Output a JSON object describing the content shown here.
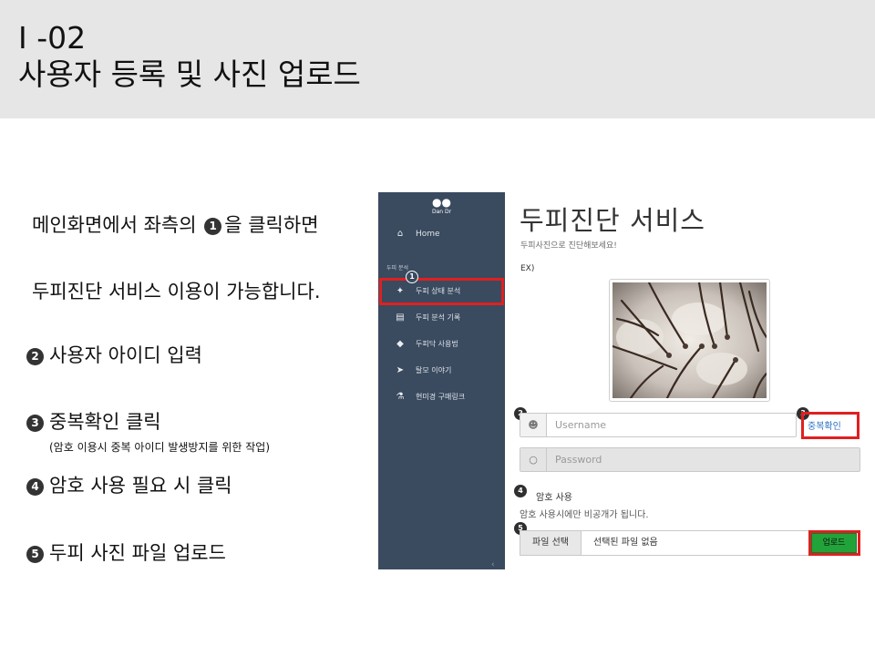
{
  "header": {
    "code": "I -02",
    "title": "사용자 등록 및 사진 업로드"
  },
  "instructions": {
    "line1_pre": "메인화면에서 좌측의 ",
    "line1_num": "1",
    "line1_post": "을 클릭하면",
    "line2": "두피진단 서비스 이용이 가능합니다.",
    "step2_num": "2",
    "step2": "사용자 아이디 입력",
    "step3_num": "3",
    "step3": "중복확인 클릭",
    "step3_note": "(암호 이용시 중복 아이디 발생방지를 위한 작업)",
    "step4_num": "4",
    "step4": "암호 사용 필요 시 클릭",
    "step5_num": "5",
    "step5": "두피 사진 파일 업로드"
  },
  "app": {
    "logo_text": "Dan Dr",
    "section_label": "두피 분석",
    "nav": [
      {
        "label": "Home",
        "icon": "home-icon"
      },
      {
        "label": "두피 상태 분석",
        "icon": "magic-wand-icon"
      },
      {
        "label": "두피 분석 기록",
        "icon": "clipboard-icon"
      },
      {
        "label": "두피닥 사용법",
        "icon": "pen-nib-icon"
      },
      {
        "label": "탈모 이야기",
        "icon": "running-person-icon"
      },
      {
        "label": "현미경 구매링크",
        "icon": "microscope-icon"
      }
    ],
    "service_title": "두피진단 서비스",
    "service_subtitle": "두피사진으로 진단해보세요!",
    "example_label": "EX)",
    "username_placeholder": "Username",
    "duplicate_check": "중복확인",
    "password_placeholder": "Password",
    "use_password": "암호 사용",
    "password_note": "암호 사용시에만 비공개가 됩니다.",
    "file_select": "파일 선택",
    "file_none": "선택된 파일 없음",
    "upload": "업로드",
    "markers": [
      "1",
      "2",
      "3",
      "4",
      "5"
    ]
  },
  "colors": {
    "sidebar": "#3a4a5f",
    "highlight": "#e02020",
    "upload": "#22a33a",
    "link": "#2b6fc2"
  }
}
